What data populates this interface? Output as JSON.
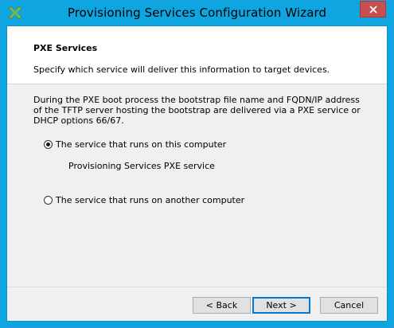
{
  "window": {
    "title": "Provisioning Services Configuration Wizard",
    "app_icon": "citrix-x-icon",
    "close_icon": "close-icon",
    "colors": {
      "titlebar": "#0ea5e0",
      "close_button": "#c74f4f",
      "icon_green": "#7ab648"
    }
  },
  "page": {
    "title": "PXE Services",
    "subtitle": "Specify which service will deliver this information to target devices.",
    "description": "During the PXE boot process the bootstrap file name and FQDN/IP address of the TFTP server hosting the bootstrap are delivered via a PXE service or DHCP options 66/67."
  },
  "options": {
    "this_computer": {
      "label": "The service that runs on this computer",
      "checked": true,
      "detail": "Provisioning Services PXE service"
    },
    "another_computer": {
      "label": "The service that runs on another computer",
      "checked": false
    }
  },
  "buttons": {
    "back": "< Back",
    "next": "Next >",
    "cancel": "Cancel"
  }
}
